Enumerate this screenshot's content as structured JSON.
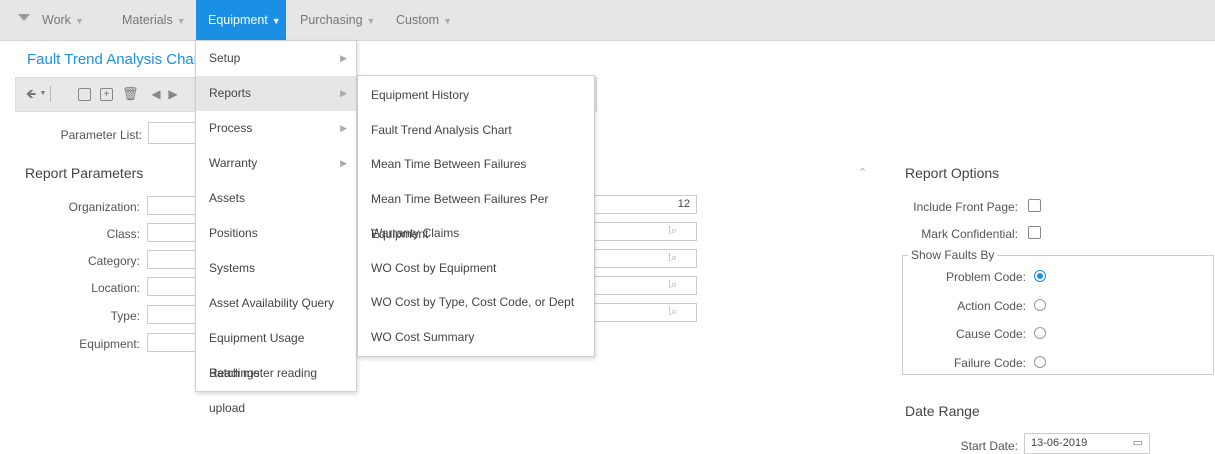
{
  "nav": {
    "items": [
      {
        "label": "Work"
      },
      {
        "label": "Materials"
      },
      {
        "label": "Equipment"
      },
      {
        "label": "Purchasing"
      },
      {
        "label": "Custom"
      }
    ]
  },
  "page": {
    "title": "Fault Trend Analysis Chart"
  },
  "parameter_list": {
    "label": "Parameter List:"
  },
  "report_parameters": {
    "title": "Report Parameters",
    "fields": [
      {
        "label": "Organization:"
      },
      {
        "label": "Class:"
      },
      {
        "label": "Category:"
      },
      {
        "label": "Location:"
      },
      {
        "label": "Type:"
      },
      {
        "label": "Equipment:"
      }
    ],
    "periods_value": "12"
  },
  "equipment_menu": {
    "items": [
      {
        "label": "Setup"
      },
      {
        "label": "Reports"
      },
      {
        "label": "Process"
      },
      {
        "label": "Warranty"
      },
      {
        "label": "Assets"
      },
      {
        "label": "Positions"
      },
      {
        "label": "Systems"
      },
      {
        "label": "Asset Availability Query"
      },
      {
        "label": "Equipment Usage Readings"
      },
      {
        "label": "Batch meter reading upload"
      }
    ]
  },
  "reports_submenu": {
    "items": [
      {
        "label": "Equipment History"
      },
      {
        "label": "Fault Trend Analysis Chart"
      },
      {
        "label": "Mean Time Between Failures"
      },
      {
        "label": "Mean Time Between Failures Per Equipment"
      },
      {
        "label": "Warranty Claims"
      },
      {
        "label": "WO Cost by Equipment"
      },
      {
        "label": "WO Cost by Type, Cost Code, or Dept"
      },
      {
        "label": "WO Cost Summary"
      }
    ]
  },
  "report_options": {
    "title": "Report Options",
    "include_front_page": "Include Front Page:",
    "mark_confidential": "Mark Confidential:",
    "show_faults_by": "Show Faults By",
    "fault_options": [
      {
        "label": "Problem Code:",
        "checked": true
      },
      {
        "label": "Action Code:",
        "checked": false
      },
      {
        "label": "Cause Code:",
        "checked": false
      },
      {
        "label": "Failure Code:",
        "checked": false
      }
    ]
  },
  "date_range": {
    "title": "Date Range",
    "start_label": "Start Date:",
    "start_value": "13-06-2019"
  },
  "colors": {
    "accent": "#1a8fe3",
    "nav_bg": "#e6e6e6"
  }
}
